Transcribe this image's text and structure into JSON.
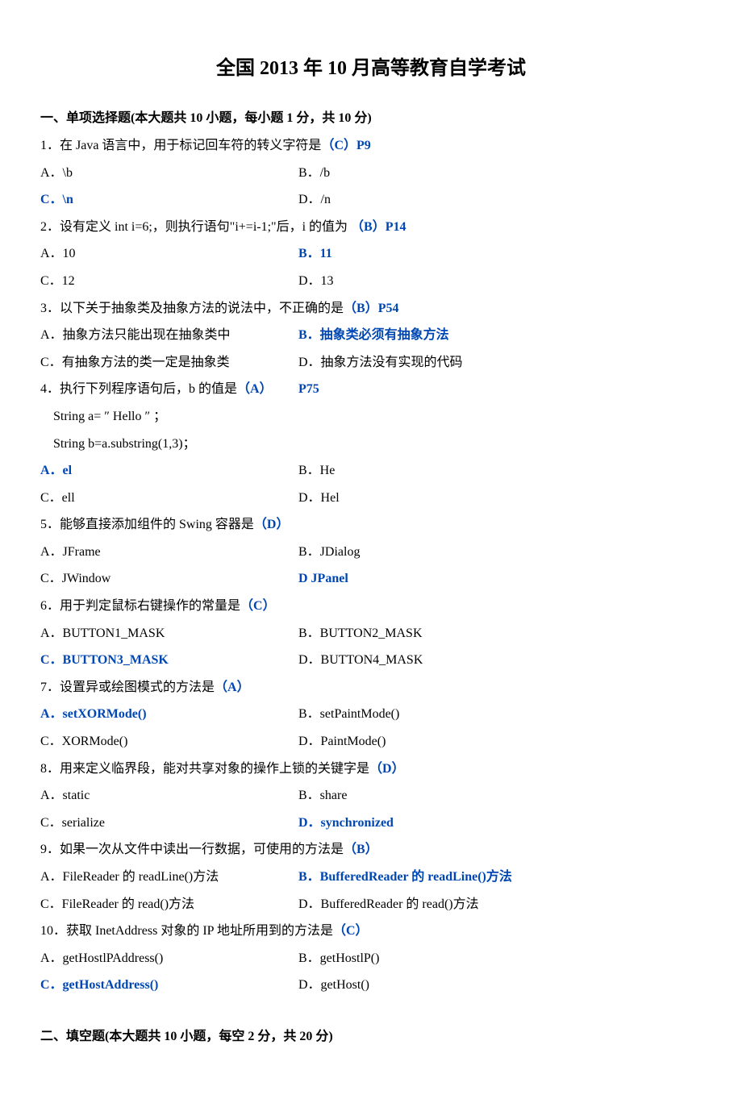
{
  "title": "全国 2013 年 10 月高等教育自学考试",
  "section1": {
    "heading": "一、单项选择题(本大题共 10 小题，每小题 1 分，共 10 分)",
    "q1": {
      "stem_pre": "1．在 Java 语言中，用于标记回车符的转义字符是",
      "stem_ans": "（C）P9",
      "a": "A．\\b",
      "b": "B．/b",
      "c": "C．\\n",
      "d": "D．/n"
    },
    "q2": {
      "stem_pre": "2．设有定义 int i=6;，则执行语句\"i+=i-1;\"后，i 的值为 ",
      "stem_ans": "（B）P14",
      "a": "A．10",
      "b": "B．11",
      "c": "C．12",
      "d": "D．13"
    },
    "q3": {
      "stem_pre": "3．以下关于抽象类及抽象方法的说法中，不正确的是",
      "stem_ans": "（B）P54",
      "a": "A．抽象方法只能出现在抽象类中",
      "b": "B．抽象类必须有抽象方法",
      "c": "C．有抽象方法的类一定是抽象类",
      "d": "D．抽象方法没有实现的代码"
    },
    "q4": {
      "stem_pre": "4．执行下列程序语句后，b 的值是",
      "stem_ans": "（A）",
      "stem_ref": "P75",
      "code1": "String a= ″ Hello ″ ；",
      "code2": "String b=a.substring(1,3)；",
      "a": "A．el",
      "b": "B．He",
      "c": "C．ell",
      "d": "D．Hel"
    },
    "q5": {
      "stem_pre": "5．能够直接添加组件的 Swing 容器是",
      "stem_ans": "（D）",
      "a": "A．JFrame",
      "b": "B．JDialog",
      "c": "C．JWindow",
      "d": "D JPanel"
    },
    "q6": {
      "stem_pre": "6．用于判定鼠标右键操作的常量是",
      "stem_ans": "（C）",
      "a": "A．BUTTON1_MASK",
      "b": "B．BUTTON2_MASK",
      "c": "C．BUTTON3_MASK",
      "d": "D．BUTTON4_MASK"
    },
    "q7": {
      "stem_pre": "7．设置异或绘图模式的方法是",
      "stem_ans": "（A）",
      "a": "A．setXORMode()",
      "b": "B．setPaintMode()",
      "c": "C．XORMode()",
      "d": "D．PaintMode()"
    },
    "q8": {
      "stem_pre": "8．用来定义临界段，能对共享对象的操作上锁的关键字是",
      "stem_ans": "（D）",
      "a": "A．static",
      "b": "B．share",
      "c": "C．serialize",
      "d": "D．synchronized"
    },
    "q9": {
      "stem_pre": "9．如果一次从文件中读出一行数据，可使用的方法是",
      "stem_ans": "（B）",
      "a": "A．FileReader 的 readLine()方法",
      "b": "B．BufferedReader 的 readLine()方法",
      "c": "C．FileReader 的 read()方法",
      "d": "D．BufferedReader 的 read()方法"
    },
    "q10": {
      "stem_pre": "10．获取 InetAddress 对象的 IP 地址所用到的方法是",
      "stem_ans": "（C）",
      "a": "A．getHostlPAddress()",
      "b": "B．getHostlP()",
      "c": "C．getHostAddress()",
      "d": "D．getHost()"
    }
  },
  "section2": {
    "heading": "二、填空题(本大题共 10 小题，每空 2 分，共 20 分)"
  }
}
